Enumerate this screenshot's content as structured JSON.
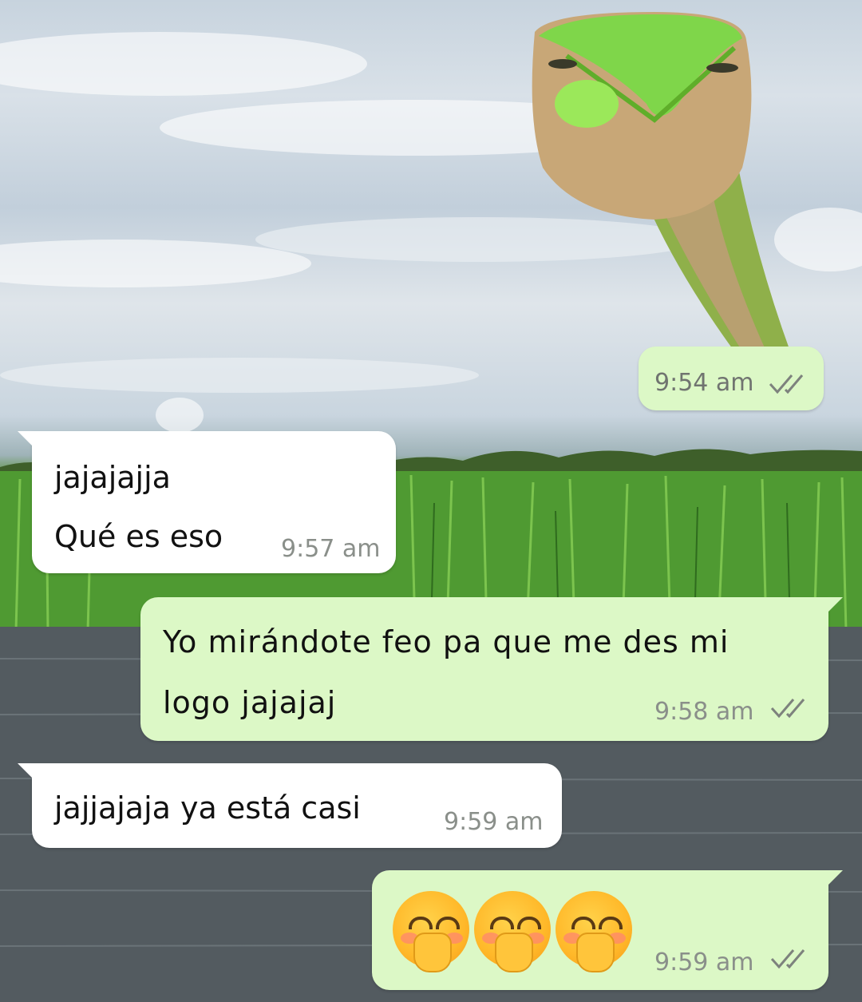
{
  "messages": [
    {
      "direction": "sent",
      "text": "",
      "time": "9:54 am",
      "read": true
    },
    {
      "direction": "received",
      "lines": [
        "jajajajja",
        "Qué es eso"
      ],
      "time": "9:57 am"
    },
    {
      "direction": "sent",
      "lines": [
        "Yo mirándote feo pa que me des mi",
        "logo jajajaj"
      ],
      "time": "9:58 am",
      "read": true
    },
    {
      "direction": "received",
      "lines": [
        "jajjajaja ya está casi"
      ],
      "time": "9:59 am"
    },
    {
      "direction": "sent",
      "emojis": [
        "face-with-hand-over-mouth-icon",
        "face-with-hand-over-mouth-icon",
        "face-with-hand-over-mouth-icon"
      ],
      "time": "9:59 am",
      "read": true
    }
  ],
  "colors": {
    "incoming_bubble": "#ffffff",
    "outgoing_bubble": "#dcf8c6",
    "timestamp": "#8a8f8a",
    "read_ticks": "#8a8f8a"
  }
}
